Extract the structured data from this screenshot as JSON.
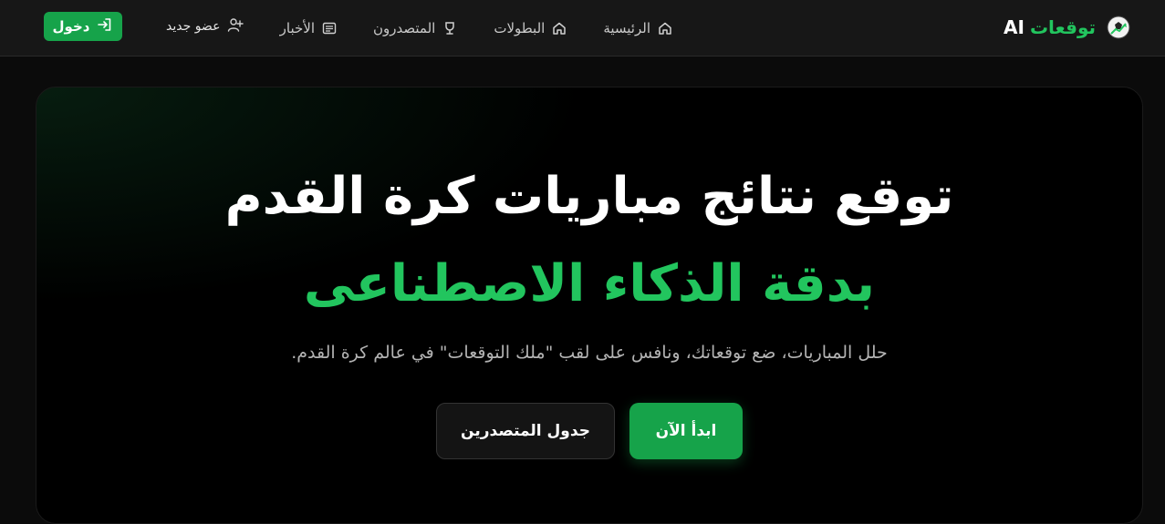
{
  "brand": {
    "name_ar": "توقعات",
    "name_en": "AI"
  },
  "nav": {
    "items": [
      {
        "label": "الرئيسية",
        "icon": "home-icon"
      },
      {
        "label": "البطولات",
        "icon": "home-icon"
      },
      {
        "label": "المتصدرون",
        "icon": "trophy-icon"
      },
      {
        "label": "الأخبار",
        "icon": "newspaper-icon"
      }
    ]
  },
  "auth": {
    "login_label": "دخول",
    "register_label": "عضو جديد"
  },
  "hero": {
    "title": "توقع نتائج مباريات كرة القدم",
    "subtitle": "بدقة الذكاء الاصطناعى",
    "description": "حلل المباريات، ضع توقعاتك، ونافس على لقب \"ملك التوقعات\" في عالم كرة القدم.",
    "primary_cta": "ابدأ الآن",
    "secondary_cta": "جدول المتصدرين"
  },
  "colors": {
    "accent": "#22c55e",
    "button": "#16a34a",
    "navbar": "#171717",
    "hero_bg": "#000000"
  }
}
